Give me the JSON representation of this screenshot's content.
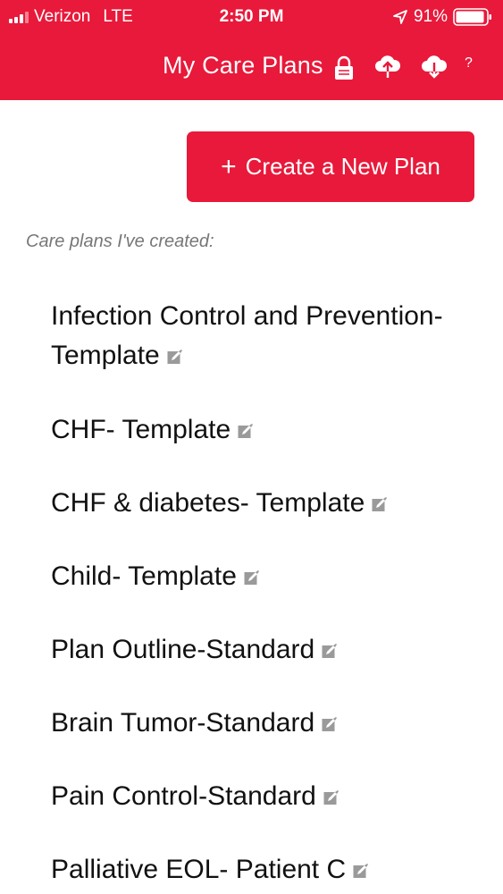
{
  "status_bar": {
    "carrier": "Verizon",
    "network": "LTE",
    "time": "2:50 PM",
    "battery": "91%"
  },
  "nav": {
    "title": "My Care Plans",
    "help": "?"
  },
  "create_button": {
    "plus": "+",
    "label": "Create a New Plan"
  },
  "section_label": "Care plans I've created:",
  "plans": [
    {
      "label": "Infection Control and Prevention- Template"
    },
    {
      "label": "CHF- Template"
    },
    {
      "label": "CHF & diabetes- Template"
    },
    {
      "label": "Child- Template"
    },
    {
      "label": "Plan Outline-Standard"
    },
    {
      "label": "Brain Tumor-Standard"
    },
    {
      "label": "Pain Control-Standard"
    },
    {
      "label": "Palliative EOL- Patient C"
    }
  ],
  "colors": {
    "brand": "#e8193a",
    "edit_icon": "#9a9a9a"
  },
  "icons": {
    "lock": "lock-icon",
    "upload": "cloud-upload-icon",
    "download": "cloud-download-icon",
    "edit": "edit-icon"
  }
}
